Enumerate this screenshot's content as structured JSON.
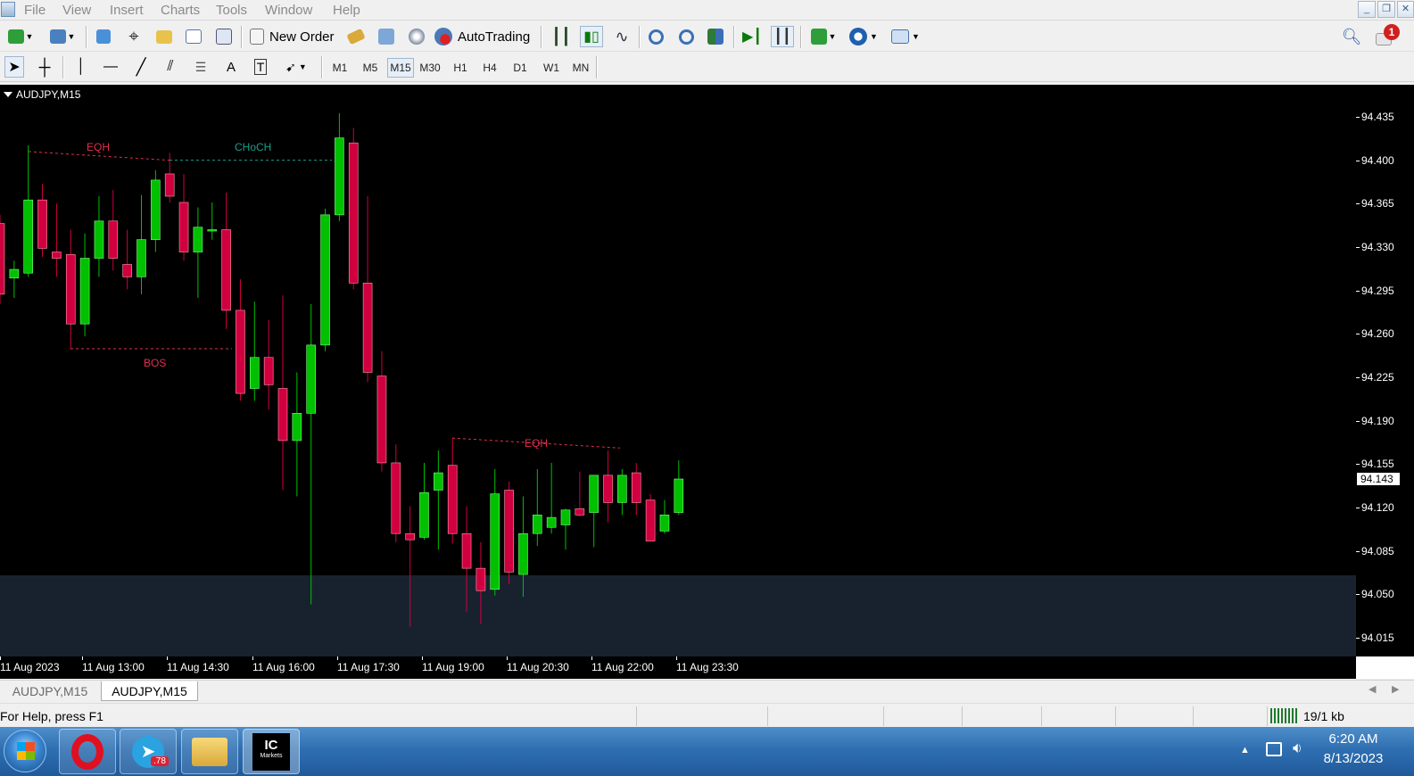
{
  "menu": [
    "File",
    "View",
    "Insert",
    "Charts",
    "Tools",
    "Window",
    "Help"
  ],
  "toolbar": {
    "new_order_label": "New Order",
    "autotrading_label": "AutoTrading",
    "notification_count": "1"
  },
  "timeframes": [
    "M1",
    "M5",
    "M15",
    "M30",
    "H1",
    "H4",
    "D1",
    "W1",
    "MN"
  ],
  "active_timeframe": "M15",
  "chart": {
    "title": "AUDJPY,M15",
    "current_price": "94.143",
    "price_labels": [
      "94.435",
      "94.400",
      "94.365",
      "94.330",
      "94.295",
      "94.260",
      "94.225",
      "94.190",
      "94.155",
      "94.120",
      "94.085",
      "94.050",
      "94.015"
    ],
    "time_labels": [
      "11 Aug 2023",
      "11 Aug 13:00",
      "11 Aug 14:30",
      "11 Aug 16:00",
      "11 Aug 17:30",
      "11 Aug 19:00",
      "11 Aug 20:30",
      "11 Aug 22:00",
      "11 Aug 23:30"
    ],
    "annotations": {
      "eqh_left": "EQH",
      "choch": "CHoCH",
      "bos": "BOS",
      "eqh_right": "EQH"
    },
    "colors": {
      "bull": "#00c000",
      "bear": "#d00040",
      "background": "#000000",
      "zone": "#18222f",
      "choch": "#16a08a",
      "marker": "#e03050"
    }
  },
  "chart_data": {
    "type": "candlestick",
    "title": "AUDJPY,M15",
    "ylim": [
      94.0,
      94.45
    ],
    "candles": [
      {
        "o": 94.349,
        "h": 94.356,
        "l": 94.284,
        "c": 94.292
      },
      {
        "o": 94.305,
        "h": 94.319,
        "l": 94.289,
        "c": 94.312
      },
      {
        "o": 94.309,
        "h": 94.412,
        "l": 94.306,
        "c": 94.368
      },
      {
        "o": 94.368,
        "h": 94.381,
        "l": 94.322,
        "c": 94.329
      },
      {
        "o": 94.326,
        "h": 94.365,
        "l": 94.306,
        "c": 94.321
      },
      {
        "o": 94.324,
        "h": 94.344,
        "l": 94.248,
        "c": 94.268
      },
      {
        "o": 94.268,
        "h": 94.341,
        "l": 94.258,
        "c": 94.321
      },
      {
        "o": 94.321,
        "h": 94.371,
        "l": 94.306,
        "c": 94.351
      },
      {
        "o": 94.351,
        "h": 94.376,
        "l": 94.311,
        "c": 94.321
      },
      {
        "o": 94.316,
        "h": 94.344,
        "l": 94.296,
        "c": 94.306
      },
      {
        "o": 94.306,
        "h": 94.372,
        "l": 94.292,
        "c": 94.336
      },
      {
        "o": 94.336,
        "h": 94.392,
        "l": 94.326,
        "c": 94.384
      },
      {
        "o": 94.389,
        "h": 94.406,
        "l": 94.366,
        "c": 94.371
      },
      {
        "o": 94.366,
        "h": 94.389,
        "l": 94.319,
        "c": 94.326
      },
      {
        "o": 94.326,
        "h": 94.362,
        "l": 94.289,
        "c": 94.346
      },
      {
        "o": 94.344,
        "h": 94.366,
        "l": 94.336,
        "c": 94.344
      },
      {
        "o": 94.344,
        "h": 94.374,
        "l": 94.264,
        "c": 94.279
      },
      {
        "o": 94.279,
        "h": 94.304,
        "l": 94.206,
        "c": 94.212
      },
      {
        "o": 94.216,
        "h": 94.286,
        "l": 94.206,
        "c": 94.241
      },
      {
        "o": 94.241,
        "h": 94.271,
        "l": 94.199,
        "c": 94.219
      },
      {
        "o": 94.216,
        "h": 94.291,
        "l": 94.134,
        "c": 94.174
      },
      {
        "o": 94.174,
        "h": 94.229,
        "l": 94.129,
        "c": 94.196
      },
      {
        "o": 94.196,
        "h": 94.284,
        "l": 94.042,
        "c": 94.251
      },
      {
        "o": 94.251,
        "h": 94.361,
        "l": 94.246,
        "c": 94.356
      },
      {
        "o": 94.356,
        "h": 94.438,
        "l": 94.351,
        "c": 94.418
      },
      {
        "o": 94.414,
        "h": 94.426,
        "l": 94.296,
        "c": 94.301
      },
      {
        "o": 94.301,
        "h": 94.371,
        "l": 94.221,
        "c": 94.229
      },
      {
        "o": 94.226,
        "h": 94.246,
        "l": 94.149,
        "c": 94.156
      },
      {
        "o": 94.156,
        "h": 94.171,
        "l": 94.092,
        "c": 94.099
      },
      {
        "o": 94.099,
        "h": 94.121,
        "l": 94.024,
        "c": 94.094
      },
      {
        "o": 94.096,
        "h": 94.156,
        "l": 94.094,
        "c": 94.132
      },
      {
        "o": 94.134,
        "h": 94.166,
        "l": 94.086,
        "c": 94.148
      },
      {
        "o": 94.154,
        "h": 94.176,
        "l": 94.091,
        "c": 94.099
      },
      {
        "o": 94.099,
        "h": 94.121,
        "l": 94.036,
        "c": 94.071
      },
      {
        "o": 94.071,
        "h": 94.092,
        "l": 94.026,
        "c": 94.053
      },
      {
        "o": 94.054,
        "h": 94.151,
        "l": 94.049,
        "c": 94.131
      },
      {
        "o": 94.134,
        "h": 94.141,
        "l": 94.058,
        "c": 94.068
      },
      {
        "o": 94.066,
        "h": 94.129,
        "l": 94.048,
        "c": 94.099
      },
      {
        "o": 94.099,
        "h": 94.151,
        "l": 94.089,
        "c": 94.114
      },
      {
        "o": 94.104,
        "h": 94.156,
        "l": 94.099,
        "c": 94.112
      },
      {
        "o": 94.106,
        "h": 94.119,
        "l": 94.086,
        "c": 94.118
      },
      {
        "o": 94.119,
        "h": 94.149,
        "l": 94.113,
        "c": 94.114
      },
      {
        "o": 94.116,
        "h": 94.146,
        "l": 94.088,
        "c": 94.146
      },
      {
        "o": 94.146,
        "h": 94.166,
        "l": 94.108,
        "c": 94.124
      },
      {
        "o": 94.124,
        "h": 94.151,
        "l": 94.114,
        "c": 94.146
      },
      {
        "o": 94.148,
        "h": 94.156,
        "l": 94.114,
        "c": 94.124
      },
      {
        "o": 94.126,
        "h": 94.131,
        "l": 94.094,
        "c": 94.093
      },
      {
        "o": 94.101,
        "h": 94.126,
        "l": 94.099,
        "c": 94.114
      },
      {
        "o": 94.116,
        "h": 94.158,
        "l": 94.114,
        "c": 94.143
      }
    ],
    "levels": [
      {
        "label": "EQH",
        "price": 94.407
      },
      {
        "label": "CHoCH",
        "price": 94.405
      },
      {
        "label": "BOS",
        "price": 94.248
      },
      {
        "label": "EQH",
        "price": 94.176
      }
    ],
    "zone": {
      "from": 94.006,
      "to": 94.07
    }
  },
  "tabs": [
    "AUDJPY,M15",
    "AUDJPY,M15"
  ],
  "status": {
    "help": "For Help, press F1",
    "traffic": "19/1 kb"
  },
  "taskbar": {
    "telegram_badge": ".78",
    "ic_markets_label": "IC",
    "ic_markets_sub": "Markets",
    "time": "6:20 AM",
    "date": "8/13/2023"
  }
}
